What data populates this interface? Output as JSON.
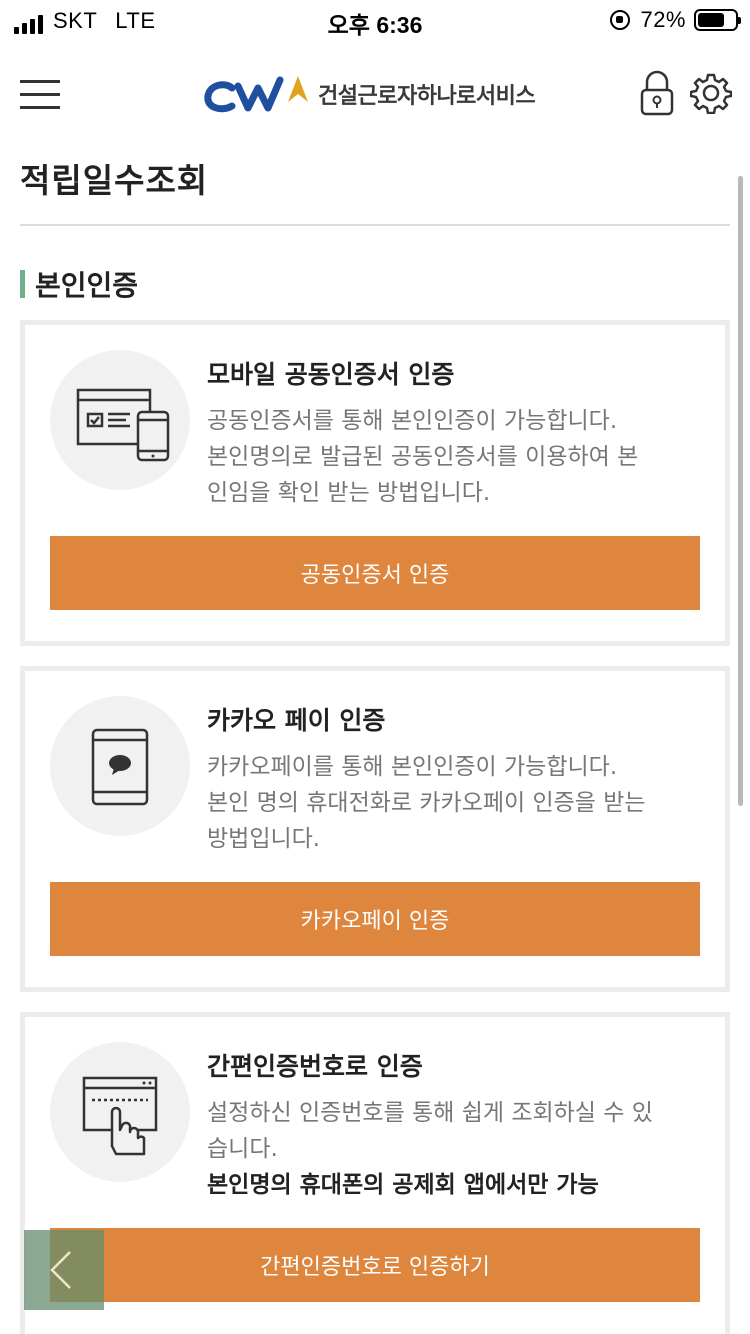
{
  "status_bar": {
    "carrier": "SKT",
    "network": "LTE",
    "time": "오후 6:36",
    "battery": "72%",
    "battery_level": 0.72
  },
  "header": {
    "logo_text": "건설근로자하나로서비스",
    "icons": [
      "menu-icon",
      "lock-icon",
      "gear-icon"
    ]
  },
  "page": {
    "title": "적립일수조회",
    "section_title": "본인인증"
  },
  "cards": [
    {
      "title": "모바일 공동인증서 인증",
      "desc": [
        "공동인증서를 통해 본인인증이 가능합니다.",
        "본인명의로 발급된 공동인증서를 이용하여 본",
        "인임을 확인 받는 방법입니다."
      ],
      "button": "공동인증서 인증",
      "icon": "certificate-device-icon"
    },
    {
      "title": "카카오 페이 인증",
      "desc": [
        "카카오페이를 통해 본인인증이 가능합니다.",
        "본인 명의 휴대전화로 카카오페이 인증을 받는",
        "방법입니다."
      ],
      "button": "카카오페이 인증",
      "icon": "phone-chat-icon"
    },
    {
      "title": "간편인증번호로 인증",
      "desc": [
        "설정하신 인증번호를 통해 쉽게 조회하실 수 있",
        "습니다."
      ],
      "desc_strong": "본인명의 휴대폰의 공제회 앱에서만 가능",
      "button": "간편인증번호로 인증하기",
      "icon": "pin-touch-icon"
    }
  ],
  "colors": {
    "accent": "#de863e",
    "section_bar": "#6fb08c",
    "logo_blue": "#1f4f9e",
    "logo_gold": "#e0a21f"
  }
}
